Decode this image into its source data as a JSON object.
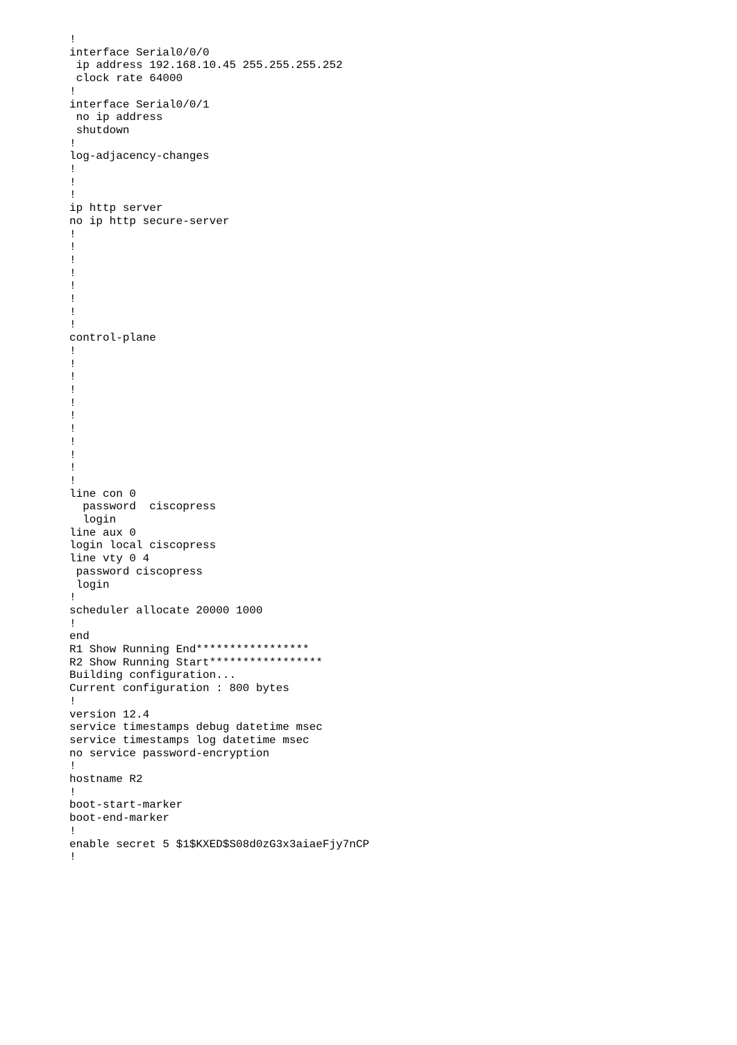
{
  "config_text": "!\ninterface Serial0/0/0\n ip address 192.168.10.45 255.255.255.252\n clock rate 64000\n!\ninterface Serial0/0/1\n no ip address\n shutdown\n!\nlog-adjacency-changes\n!\n!\n!\nip http server\nno ip http secure-server\n!\n!\n!\n!\n!\n!\n!\n!\ncontrol-plane\n!\n!\n!\n!\n!\n!\n!\n!\n!\n!\n!\nline con 0\n  password  ciscopress\n  login\nline aux 0\nlogin local ciscopress\nline vty 0 4\n password ciscopress\n login\n!\nscheduler allocate 20000 1000\n!\nend\nR1 Show Running End*****************\nR2 Show Running Start*****************\nBuilding configuration...\nCurrent configuration : 800 bytes\n!\nversion 12.4\nservice timestamps debug datetime msec\nservice timestamps log datetime msec\nno service password-encryption\n!\nhostname R2\n!\nboot-start-marker\nboot-end-marker\n!\nenable secret 5 $1$KXED$S08d0zG3x3aiaeFjy7nCP\n!"
}
